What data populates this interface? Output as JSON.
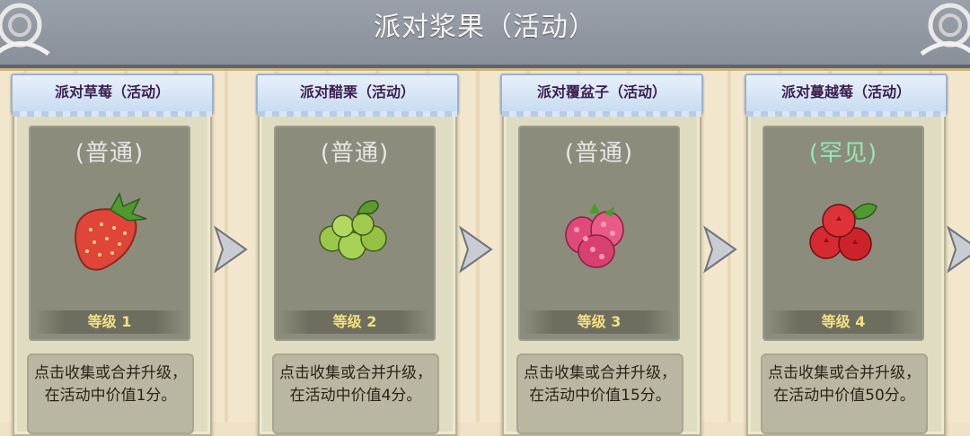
{
  "header": {
    "title": "派对浆果（活动）"
  },
  "cards": [
    {
      "name": "派对草莓（活动）",
      "rarity": "(普通)",
      "level": "等级 1",
      "description": "点击收集或合并升级，在活动中价值1分。",
      "fruit_icon": "strawberry-icon"
    },
    {
      "name": "派对醋栗（活动）",
      "rarity": "(普通)",
      "level": "等级 2",
      "description": "点击收集或合并升级，在活动中价值4分。",
      "fruit_icon": "gooseberry-icon"
    },
    {
      "name": "派对覆盆子（活动）",
      "rarity": "(普通)",
      "level": "等级 3",
      "description": "点击收集或合并升级，在活动中价值15分。",
      "fruit_icon": "raspberry-icon"
    },
    {
      "name": "派对蔓越莓（活动）",
      "rarity": "(罕见)",
      "level": "等级 4",
      "description": "点击收集或合并升级，在活动中价值50分。",
      "fruit_icon": "cranberry-icon"
    }
  ],
  "colors": {
    "rare": "#8fe8b8",
    "common": "#e6e6e6",
    "level": "#f3e080"
  }
}
